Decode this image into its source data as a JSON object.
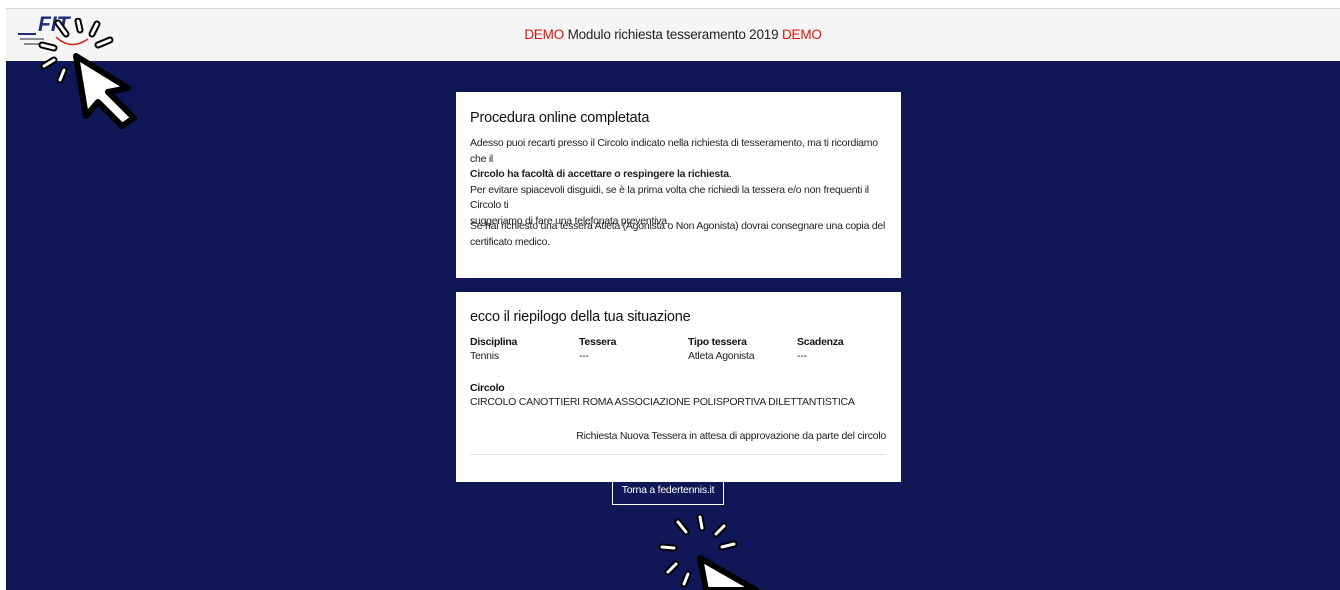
{
  "header": {
    "demo_left": "DEMO",
    "title": " Modulo richiesta tesseramento 2019 ",
    "demo_right": "DEMO",
    "logo_text": "FIT"
  },
  "completion": {
    "title": "Procedura online completata",
    "para1_a": "Adesso puoi recarti presso il Circolo indicato nella richiesta di tesseramento, ma ti ricordiamo che il",
    "para1_b": "Circolo ha facoltà di accettare o respingere la richiesta",
    "para1_c": ".",
    "para2_line1": "Per evitare spiacevoli disguidi, se è la prima volta che richiedi la tessera e/o non frequenti il Circolo ti",
    "para2_line2": "suggeriamo di fare una telefonata preventiva.",
    "para3_line1": "Se hai richiesto una tessera Atleta (Agonista o Non Agonista) dovrai consegnare una copia del",
    "para3_line2": "certificato medico."
  },
  "summary": {
    "title": "ecco il riepilogo della tua situazione",
    "columns": [
      {
        "header": "Disciplina",
        "value": "Tennis"
      },
      {
        "header": "Tessera",
        "value": "---"
      },
      {
        "header": "Tipo tessera",
        "value": "Atleta Agonista"
      },
      {
        "header": "Scadenza",
        "value": "---"
      }
    ],
    "circolo_label": "Circolo",
    "circolo_value": "CIRCOLO CANOTTIERI ROMA ASSOCIAZIONE POLISPORTIVA DILETTANTISTICA",
    "status": "Richiesta Nuova Tessera in attesa di approvazione da parte del circolo"
  },
  "footer": {
    "back_button": "Torna a federtennis.it"
  },
  "colors": {
    "background": "#0f1756",
    "demo": "#e3120b",
    "card": "#ffffff"
  }
}
